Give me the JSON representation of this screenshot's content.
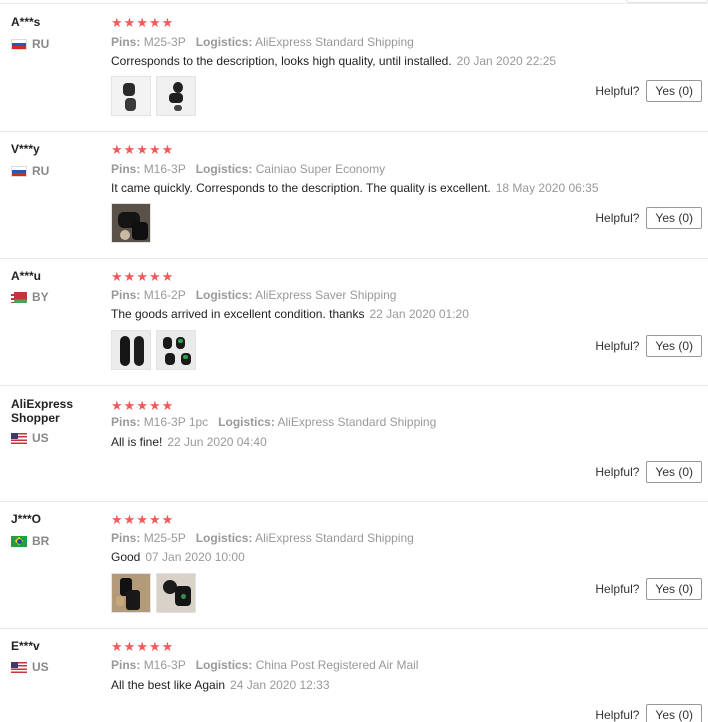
{
  "labels": {
    "pins": "Pins:",
    "logistics": "Logistics:",
    "helpful": "Helpful?",
    "star_icon": "star-icon"
  },
  "colors": {
    "stars": "#f05a5a",
    "meta": "#999999",
    "separator": "#e6e6e6"
  },
  "reviews": [
    {
      "name": "A***s",
      "country": "RU",
      "rating": 5,
      "pins": "M25-3P",
      "logistics": "AliExpress Standard Shipping",
      "text": "Corresponds to the description, looks high quality, until installed.",
      "date": "20 Jan 2020 22:25",
      "photos": 2,
      "yes": "Yes (0)"
    },
    {
      "name": "V***y",
      "country": "RU",
      "rating": 5,
      "pins": "M16-3P",
      "logistics": "Cainiao Super Economy",
      "text": "It came quickly. Corresponds to the description. The quality is excellent.",
      "date": "18 May 2020 06:35",
      "photos": 1,
      "yes": "Yes (0)"
    },
    {
      "name": "A***u",
      "country": "BY",
      "rating": 5,
      "pins": "M16-2P",
      "logistics": "AliExpress Saver Shipping",
      "text": "The goods arrived in excellent condition. thanks",
      "date": "22 Jan 2020 01:20",
      "photos": 2,
      "yes": "Yes (0)"
    },
    {
      "name": "AliExpress Shopper",
      "country": "US",
      "rating": 5,
      "pins": "M16-3P 1pc",
      "logistics": "AliExpress Standard Shipping",
      "text": "All is fine!",
      "date": "22 Jun 2020 04:40",
      "photos": 0,
      "yes": "Yes (0)"
    },
    {
      "name": "J***O",
      "country": "BR",
      "rating": 5,
      "pins": "M25-5P",
      "logistics": "AliExpress Standard Shipping",
      "text": "Good",
      "date": "07 Jan 2020 10:00",
      "photos": 2,
      "yes": "Yes (0)"
    },
    {
      "name": "E***v",
      "country": "US",
      "rating": 5,
      "pins": "M16-3P",
      "logistics": "China Post Registered Air Mail",
      "text": "All the best like Again",
      "date": "24 Jan 2020 12:33",
      "photos": 0,
      "yes": "Yes (0)"
    }
  ]
}
